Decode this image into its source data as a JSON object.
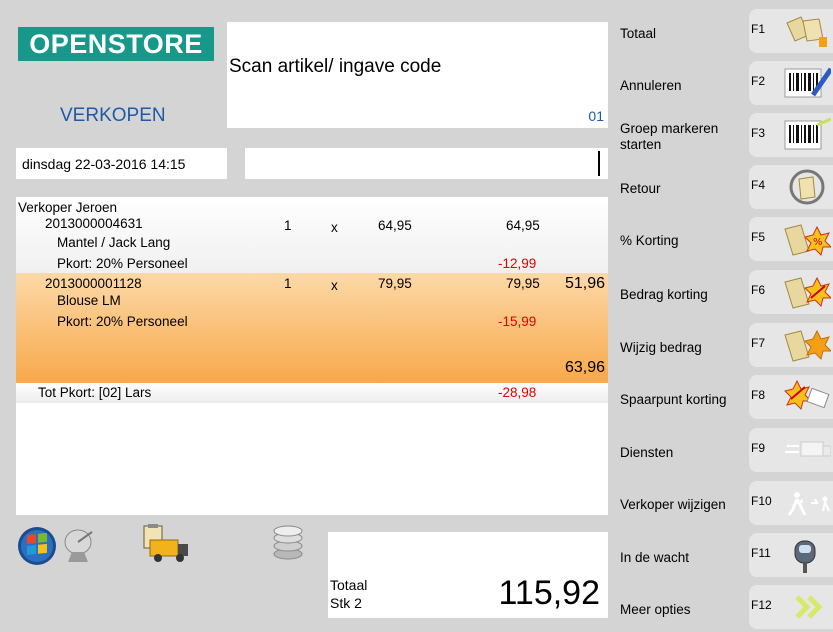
{
  "header": {
    "logo": "OPENSTORE",
    "mode": "VERKOPEN",
    "scan_prompt": "Scan artikel/ ingave code",
    "scan_code": "01",
    "datetime": "dinsdag 22-03-2016 14:15"
  },
  "receipt": {
    "seller": "Verkoper Jeroen",
    "items": [
      {
        "barcode": "2013000004631",
        "qty": "1",
        "x": "x",
        "price": "64,95",
        "amount": "64,95",
        "name": "Mantel / Jack Lang",
        "discount_label": "Pkort: 20%  Personeel",
        "discount_amount": "-12,99",
        "subtotal": "51,96"
      },
      {
        "barcode": "2013000001128",
        "qty": "1",
        "x": "x",
        "price": "79,95",
        "amount": "79,95",
        "name": "Blouse LM",
        "discount_label": "Pkort: 20%  Personeel",
        "discount_amount": "-15,99",
        "subtotal": "63,96"
      }
    ],
    "total_discount_label": "Tot Pkort: [02] Lars",
    "total_discount_amount": "-28,98"
  },
  "totals": {
    "label": "Totaal",
    "count": "Stk  2",
    "amount": "115,92"
  },
  "functions": [
    {
      "label": "Totaal",
      "key": "F1",
      "icon": "shopping-bags-icon"
    },
    {
      "label": "Annuleren",
      "key": "F2",
      "icon": "barcode-cancel-icon"
    },
    {
      "label": "Groep markeren starten",
      "key": "F3",
      "icon": "barcode-icon"
    },
    {
      "label": "Retour",
      "key": "F4",
      "icon": "return-bag-icon"
    },
    {
      "label": "% Korting",
      "key": "F5",
      "icon": "percent-discount-icon"
    },
    {
      "label": "Bedrag korting",
      "key": "F6",
      "icon": "amount-discount-icon"
    },
    {
      "label": "Wijzig bedrag",
      "key": "F7",
      "icon": "change-amount-icon"
    },
    {
      "label": "Spaarpunt korting",
      "key": "F8",
      "icon": "savings-points-icon"
    },
    {
      "label": "Diensten",
      "key": "F9",
      "icon": "services-truck-icon"
    },
    {
      "label": "Verkoper wijzigen",
      "key": "F10",
      "icon": "change-seller-icon"
    },
    {
      "label": "In de wacht",
      "key": "F11",
      "icon": "parking-meter-icon"
    },
    {
      "label": "Meer opties",
      "key": "F12",
      "icon": "more-options-icon"
    }
  ],
  "colors": {
    "brand": "#17988a",
    "mode_text": "#1f5aa6",
    "selected_row": "#f8a84a",
    "discount_text": "#e00000"
  }
}
